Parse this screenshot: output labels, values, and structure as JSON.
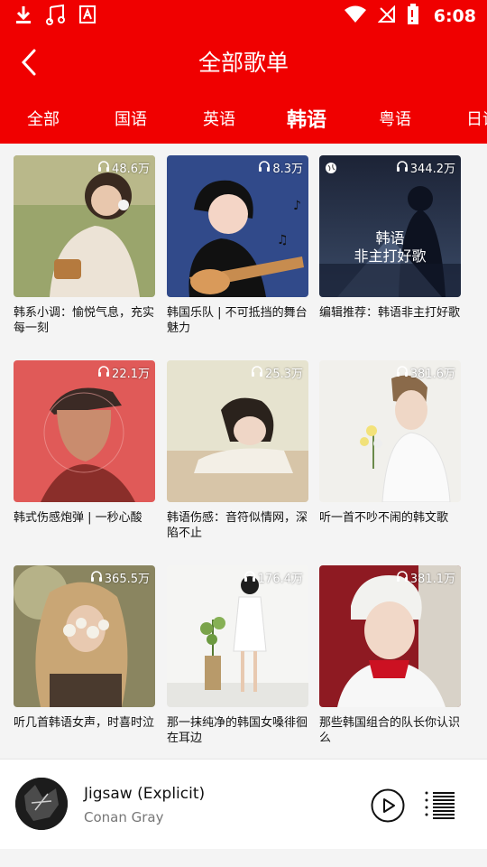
{
  "status_bar": {
    "time": "6:08"
  },
  "header": {
    "title": "全部歌单"
  },
  "tabs": [
    {
      "label": "全部"
    },
    {
      "label": "国语"
    },
    {
      "label": "英语"
    },
    {
      "label": "韩语",
      "active": true
    },
    {
      "label": "粤语"
    },
    {
      "label": "日语"
    }
  ],
  "playlists": [
    {
      "plays": "48.6万",
      "title": "韩系小调：愉悦气息，充实每一刻"
    },
    {
      "plays": "8.3万",
      "title": "韩国乐队 | 不可抵挡的舞台魅力"
    },
    {
      "plays": "344.2万",
      "title": "编辑推荐：韩语非主打好歌",
      "cover_text_1": "韩语",
      "cover_text_2": "非主打好歌"
    },
    {
      "plays": "22.1万",
      "title": "韩式伤感炮弹 | 一秒心酸"
    },
    {
      "plays": "25.3万",
      "title": "韩语伤感：音符似情网，深陷不止"
    },
    {
      "plays": "381.6万",
      "title": "听一首不吵不闹的韩文歌"
    },
    {
      "plays": "365.5万",
      "title": "听几首韩语女声，时喜时泣"
    },
    {
      "plays": "176.4万",
      "title": "那一抹纯净的韩国女嗓徘徊在耳边"
    },
    {
      "plays": "381.1万",
      "title": "那些韩国组合的队长你认识么"
    }
  ],
  "player": {
    "song": "Jigsaw (Explicit)",
    "artist": "Conan Gray"
  },
  "colors": {
    "primary": "#f00000",
    "background": "#f4f4f4"
  }
}
